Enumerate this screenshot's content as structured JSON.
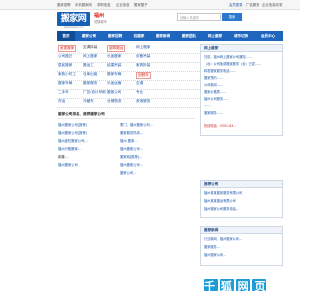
{
  "topbar": {
    "items": [
      "搬家招聘",
      "手机搬家网",
      "求职信息",
      "企业信息",
      "搬家圈子"
    ],
    "right": [
      "会员登录",
      "广告服务",
      "企业信息收录"
    ]
  },
  "header": {
    "logo_text": "搬家网",
    "logo_sub": "www.banjia.com",
    "city": "福州",
    "city_switch": "切换城市",
    "search_placeholder": "请输入关键字",
    "search_button": "搜索"
  },
  "nav": {
    "items": [
      "首页",
      "搬家公司",
      "搬家招聘",
      "找搬家",
      "搬家新闻",
      "搬家团队",
      "网上搬家",
      "城市切换",
      "会员中心"
    ]
  },
  "categories": [
    [
      "家居搬家",
      "空调拆装",
      "钢琴搬运",
      "网上搬家"
    ],
    [
      "公司搬迁",
      "网上搬家",
      "长途搬家",
      "设备吊装"
    ],
    [
      "居民搬家",
      "搬运工",
      "起重吊装",
      "家具拆装"
    ],
    [
      "家政小时工",
      "仓库出租",
      "搬家车辆",
      "回程车"
    ],
    [
      "搬家车辆",
      "搬家服务",
      "长途运输",
      "空调"
    ],
    [
      "二手车",
      "广告/设计印刷",
      "搬家公司",
      "专业"
    ],
    [
      "货运",
      "冷藏车",
      "仓储物流",
      "其他服务"
    ]
  ],
  "notice_box": {
    "title": "网上搬家",
    "lines": [
      "日前，福州网上搬家公司通知……",
      "（台）公司免费搬家服务（台）已发……",
      "转发搬家服务电话……",
      "搬家预约……",
      "公司新闻……",
      "搬家价格表……",
      "福州公司服务……",
      "……",
      "搬家服务……"
    ]
  },
  "hot_phone": "热线电话：0591-83…",
  "recommend": {
    "title": "推荐公司",
    "lines": [
      "福州某某搬家服务有限公司",
      "福州某某搬运有限公司",
      "福州搬家公司服务电话…"
    ]
  },
  "news": {
    "title": "搬家新闻",
    "lines": [
      "行业新闻、福州搬家公司…",
      "搬家服务…",
      "福州搬家公司…"
    ]
  },
  "left_col": {
    "title": "搬家公司排名、推荐搬家公司",
    "lines": [
      "福州搬家公司[推荐]",
      "福州搬家公司[推荐]",
      "福州鑫旺搬家公司…",
      "福州兴隆搬家…",
      "新疆…",
      "福州搬家公司"
    ]
  },
  "mid_col": {
    "lines": [
      "厦门、福州搬家公司…",
      "搬家服务热线…",
      "福州 搬家…",
      "福州搬家公司…",
      "搬家网[推荐]…",
      "福州搬家公司…",
      "搬家公司…"
    ]
  },
  "watermark": {
    "text": "千 狐 网 页"
  }
}
